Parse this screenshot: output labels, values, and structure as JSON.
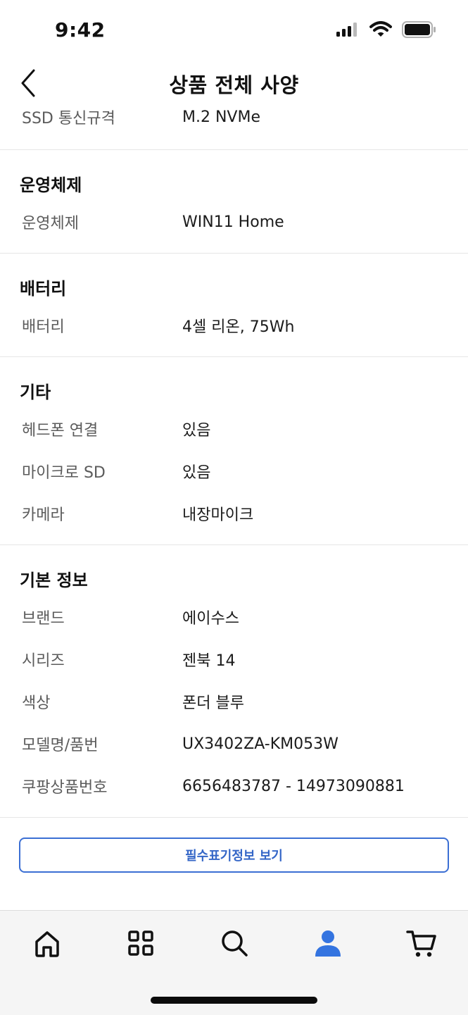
{
  "status_bar": {
    "time": "9:42"
  },
  "header": {
    "title": "상품 전체 사양"
  },
  "partial_row": {
    "label": "SSD 통신규격",
    "value": "M.2 NVMe"
  },
  "sections": [
    {
      "title": "운영체제",
      "rows": [
        {
          "label": "운영체제",
          "value": "WIN11 Home"
        }
      ]
    },
    {
      "title": "배터리",
      "rows": [
        {
          "label": "배터리",
          "value": "4셀 리온, 75Wh"
        }
      ]
    },
    {
      "title": "기타",
      "rows": [
        {
          "label": "헤드폰 연결",
          "value": "있음"
        },
        {
          "label": "마이크로 SD",
          "value": "있음"
        },
        {
          "label": "카메라",
          "value": "내장마이크"
        }
      ]
    },
    {
      "title": "기본 정보",
      "rows": [
        {
          "label": "브랜드",
          "value": "에이수스"
        },
        {
          "label": "시리즈",
          "value": "젠북 14"
        },
        {
          "label": "색상",
          "value": "폰더 블루"
        },
        {
          "label": "모델명/품번",
          "value": "UX3402ZA-KM053W"
        },
        {
          "label": "쿠팡상품번호",
          "value": "6656483787 - 14973090881"
        }
      ]
    }
  ],
  "action_button": {
    "label": "필수표기정보 보기"
  },
  "tab_bar": {
    "items": [
      {
        "icon": "home-icon"
      },
      {
        "icon": "categories-grid-icon"
      },
      {
        "icon": "search-icon"
      },
      {
        "icon": "user-icon",
        "active": true
      },
      {
        "icon": "cart-icon"
      }
    ],
    "active_color": "#3474e0",
    "inactive_color": "#111111"
  },
  "colors": {
    "accent": "#3b6fd4"
  }
}
